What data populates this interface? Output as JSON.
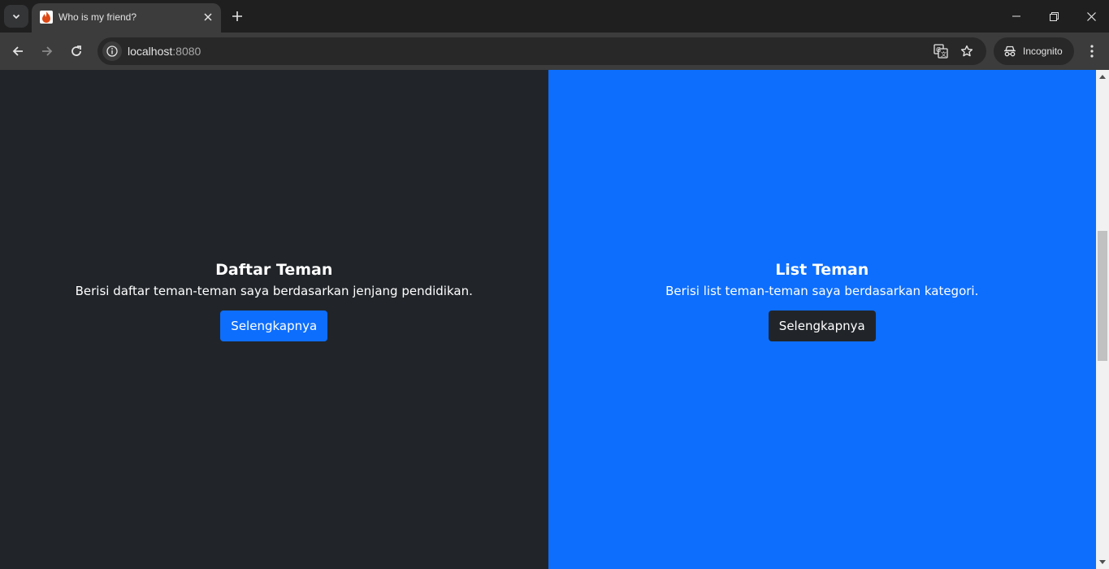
{
  "browser": {
    "tab": {
      "title": "Who is my friend?",
      "favicon": "codeigniter-flame-icon"
    },
    "url": {
      "host": "localhost",
      "port": ":8080"
    },
    "profile_label": "Incognito"
  },
  "page": {
    "left_panel": {
      "title": "Daftar Teman",
      "description": "Berisi daftar teman-teman saya berdasarkan jenjang pendidikan.",
      "button_label": "Selengkapnya",
      "background": "#212529",
      "button_color": "#0d6efd"
    },
    "right_panel": {
      "title": "List Teman",
      "description": "Berisi list teman-teman saya berdasarkan kategori.",
      "button_label": "Selengkapnya",
      "background": "#0d6efd",
      "button_color": "#212529"
    }
  }
}
